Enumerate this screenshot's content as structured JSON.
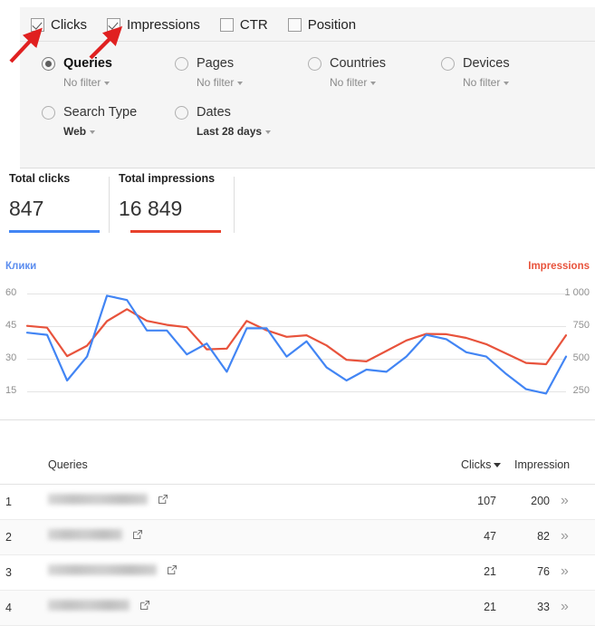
{
  "metrics": {
    "items": [
      {
        "label": "Clicks",
        "checked": true
      },
      {
        "label": "Impressions",
        "checked": true
      },
      {
        "label": "CTR",
        "checked": false
      },
      {
        "label": "Position",
        "checked": false
      }
    ]
  },
  "filters": {
    "row1": [
      {
        "name": "Queries",
        "selected": true,
        "sub": "No filter",
        "sub_strong": false
      },
      {
        "name": "Pages",
        "selected": false,
        "sub": "No filter",
        "sub_strong": false
      },
      {
        "name": "Countries",
        "selected": false,
        "sub": "No filter",
        "sub_strong": false
      },
      {
        "name": "Devices",
        "selected": false,
        "sub": "No filter",
        "sub_strong": false
      }
    ],
    "row2": [
      {
        "name": "Search Type",
        "selected": false,
        "sub": "Web",
        "sub_strong": true
      },
      {
        "name": "Dates",
        "selected": false,
        "sub": "Last 28 days",
        "sub_strong": true
      }
    ]
  },
  "totals": [
    {
      "title": "Total clicks",
      "value": "847",
      "color": "#4285f4"
    },
    {
      "title": "Total impressions",
      "value": "16 849",
      "color": "#e8412c"
    }
  ],
  "chart_data": {
    "type": "line",
    "title": "",
    "xlabel": "",
    "grid": true,
    "legend": [
      {
        "name": "Клики",
        "color": "#4285f4",
        "position": "top-left",
        "axis": "left"
      },
      {
        "name": "Impressions",
        "color": "#e8533c",
        "position": "top-right",
        "axis": "right"
      }
    ],
    "left_axis": {
      "label": "Клики",
      "ticks": [
        60,
        45,
        30,
        15
      ],
      "ylim": [
        10,
        65
      ]
    },
    "right_axis": {
      "label": "Impressions",
      "ticks": [
        "1 000",
        "750",
        "500",
        "250"
      ],
      "ylim": [
        167,
        1083
      ]
    },
    "x": [
      1,
      2,
      3,
      4,
      5,
      6,
      7,
      8,
      9,
      10,
      11,
      12,
      13,
      14,
      15,
      16,
      17,
      18,
      19,
      20,
      21,
      22,
      23,
      24,
      25,
      26,
      27,
      28
    ],
    "series": [
      {
        "name": "Клики",
        "color": "#4285f4",
        "axis": "left",
        "values": [
          42,
          41,
          20,
          31,
          59,
          57,
          43,
          43,
          32,
          37,
          24,
          44,
          44,
          31,
          38,
          26,
          20,
          25,
          24,
          31,
          41,
          39,
          33,
          31,
          23,
          16,
          14,
          31
        ]
      },
      {
        "name": "Impressions",
        "color": "#e8533c",
        "axis": "right",
        "values": [
          752,
          738,
          520,
          600,
          788,
          880,
          790,
          760,
          742,
          572,
          578,
          790,
          718,
          668,
          680,
          602,
          492,
          480,
          560,
          640,
          690,
          688,
          660,
          612,
          540,
          468,
          458,
          680
        ]
      }
    ]
  },
  "table": {
    "headers": {
      "index": "",
      "queries": "Queries",
      "clicks": "Clicks",
      "impressions": "Impression"
    },
    "sorted_by": "Clicks",
    "sort_direction": "desc",
    "rows": [
      {
        "index": "1",
        "query": "",
        "query_redacted": true,
        "query_width": 110,
        "clicks": "107",
        "impressions": "200",
        "expand": "»"
      },
      {
        "index": "2",
        "query": "",
        "query_redacted": true,
        "query_width": 82,
        "clicks": "47",
        "impressions": "82",
        "expand": "»"
      },
      {
        "index": "3",
        "query": "",
        "query_redacted": true,
        "query_width": 120,
        "clicks": "21",
        "impressions": "76",
        "expand": "»"
      },
      {
        "index": "4",
        "query": "",
        "query_redacted": true,
        "query_width": 90,
        "clicks": "21",
        "impressions": "33",
        "expand": "»"
      }
    ]
  },
  "annotations": {
    "arrow_color": "#e02020",
    "arrows": [
      {
        "name": "arrow-to-clicks-checkbox"
      },
      {
        "name": "arrow-to-impressions-checkbox"
      }
    ]
  }
}
